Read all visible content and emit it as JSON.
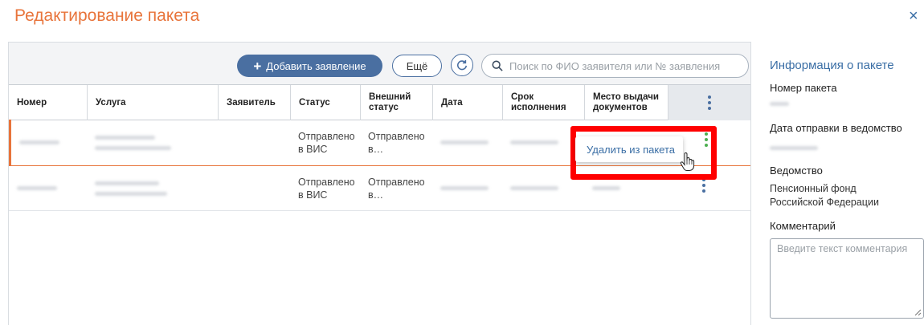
{
  "dialog": {
    "title": "Редактирование пакета",
    "close": "×"
  },
  "toolbar": {
    "add_label": "Добавить заявление",
    "more_label": "Ещё",
    "search_placeholder": "Поиск по ФИО заявителя или № заявления"
  },
  "table": {
    "columns": [
      "Номер",
      "Услуга",
      "Заявитель",
      "Статус",
      "Внешний статус",
      "Дата",
      "Срок исполнения",
      "Место выдачи документов"
    ],
    "rows": [
      {
        "status": "Отправлено в ВИС",
        "ext_status": "Отправлено в…",
        "selected": true
      },
      {
        "status": "Отправлено в ВИС",
        "ext_status": "Отправлено в…",
        "selected": false
      }
    ]
  },
  "context_menu": {
    "remove_label": "Удалить из пакета"
  },
  "side_panel": {
    "title": "Информация о пакете",
    "package_number_label": "Номер пакета",
    "sent_date_label": "Дата отправки в ведомство",
    "agency_label": "Ведомство",
    "agency_value": "Пенсионный фонд Российской Федерации",
    "comment_label": "Комментарий",
    "comment_placeholder": "Введите текст комментария"
  },
  "colors": {
    "accent": "#e8743b",
    "primary": "#4a6fa1",
    "link": "#3a6ea5",
    "highlight": "#ff0000",
    "menu_dots_active": "#4caf50"
  },
  "icons": [
    "plus-icon",
    "refresh-icon",
    "search-icon",
    "close-icon",
    "kebab-menu-icon",
    "hand-cursor-icon",
    "resize-grip-icon"
  ]
}
